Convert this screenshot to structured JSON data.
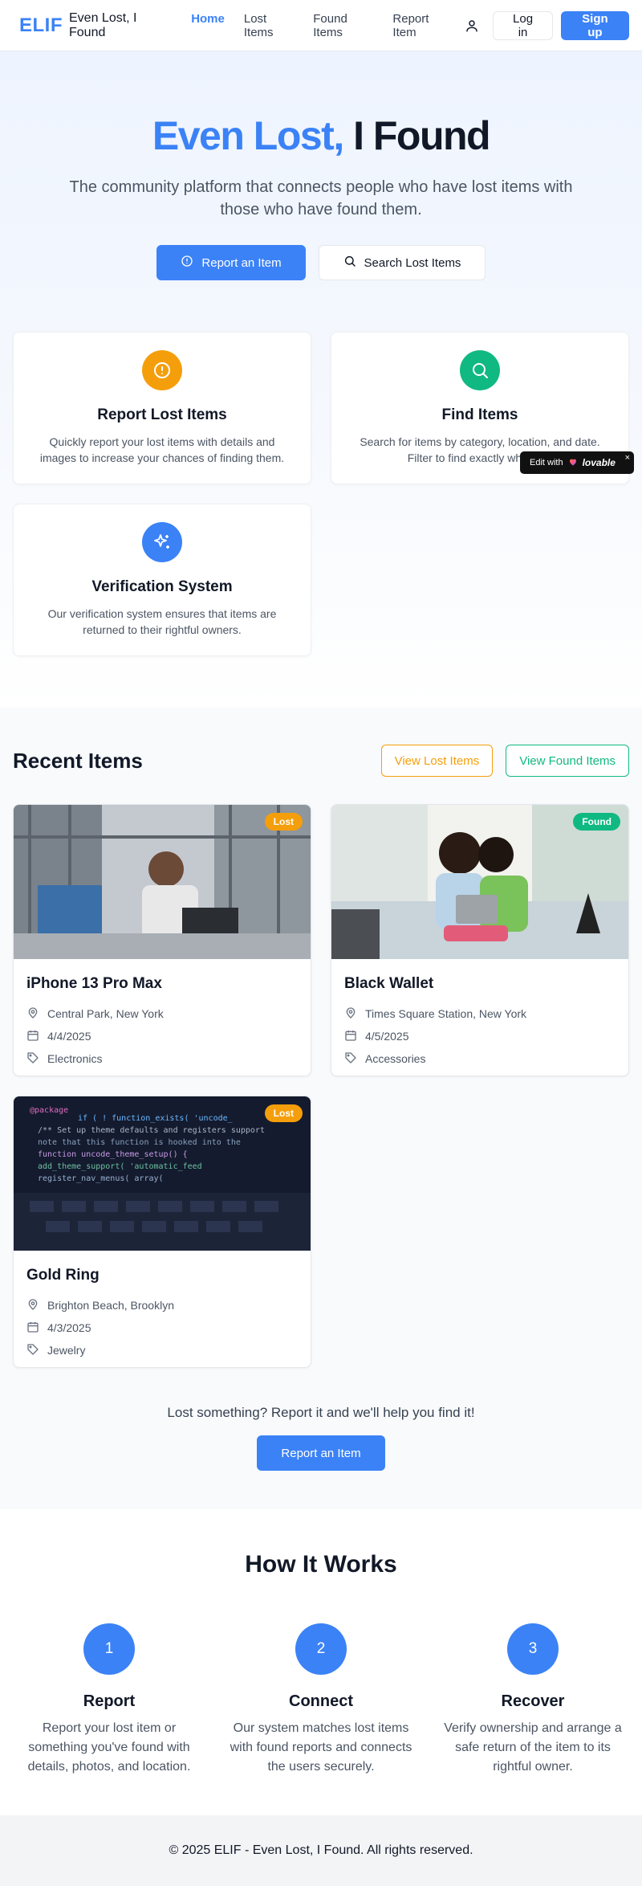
{
  "header": {
    "logo": "ELIF",
    "brand": "Even Lost, I Found",
    "nav": [
      "Home",
      "Lost Items",
      "Found Items",
      "Report Item"
    ],
    "login": "Log in",
    "signup": "Sign up"
  },
  "hero": {
    "title_accent": "Even Lost,",
    "title_rest": " I Found",
    "subtitle": "The community platform that connects people who have lost items with those who have found them.",
    "primary_btn": "Report an Item",
    "secondary_btn": "Search Lost Items"
  },
  "features": [
    {
      "title": "Report Lost Items",
      "text": "Quickly report your lost items with details and images to increase your chances of finding them.",
      "icon": "alert-circle-icon",
      "color": "#f59e0b"
    },
    {
      "title": "Find Items",
      "text": "Search for items by category, location, and date. Filter to find exactly what you",
      "icon": "search-icon",
      "color": "#10b981"
    },
    {
      "title": "Verification System",
      "text": "Our verification system ensures that items are returned to their rightful owners.",
      "icon": "sparkles-icon",
      "color": "#3b82f6"
    }
  ],
  "recent": {
    "title": "Recent Items",
    "view_lost": "View Lost Items",
    "view_found": "View Found Items",
    "items": [
      {
        "name": "iPhone 13 Pro Max",
        "status": "Lost",
        "location": "Central Park, New York",
        "date": "4/4/2025",
        "category": "Electronics"
      },
      {
        "name": "Black Wallet",
        "status": "Found",
        "location": "Times Square Station, New York",
        "date": "4/5/2025",
        "category": "Accessories"
      },
      {
        "name": "Gold Ring",
        "status": "Lost",
        "location": "Brighton Beach, Brooklyn",
        "date": "4/3/2025",
        "category": "Jewelry"
      }
    ],
    "cta_text": "Lost something? Report it and we'll help you find it!",
    "cta_btn": "Report an Item"
  },
  "how": {
    "title": "How It Works",
    "steps": [
      {
        "num": "1",
        "title": "Report",
        "text": "Report your lost item or something you've found with details, photos, and location."
      },
      {
        "num": "2",
        "title": "Connect",
        "text": "Our system matches lost items with found reports and connects the users securely."
      },
      {
        "num": "3",
        "title": "Recover",
        "text": "Verify ownership and arrange a safe return of the item to its rightful owner."
      }
    ]
  },
  "footer": {
    "text": "© 2025 ELIF - Even Lost, I Found. All rights reserved."
  },
  "badge": {
    "edit_with": "Edit with",
    "brand": "lovable",
    "close": "×"
  }
}
